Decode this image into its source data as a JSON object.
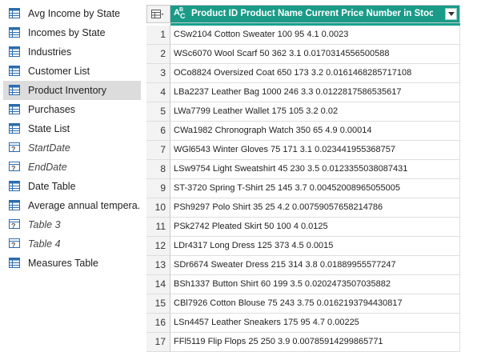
{
  "sidebar": {
    "items": [
      {
        "label": "Avg Income by State",
        "type": "table",
        "selected": false
      },
      {
        "label": "Incomes by State",
        "type": "table",
        "selected": false
      },
      {
        "label": "Industries",
        "type": "table",
        "selected": false
      },
      {
        "label": "Customer List",
        "type": "table",
        "selected": false
      },
      {
        "label": "Product Inventory",
        "type": "table",
        "selected": true
      },
      {
        "label": "Purchases",
        "type": "table",
        "selected": false
      },
      {
        "label": "State List",
        "type": "table",
        "selected": false
      },
      {
        "label": "StartDate",
        "type": "parameter",
        "selected": false
      },
      {
        "label": "EndDate",
        "type": "parameter",
        "selected": false
      },
      {
        "label": "Date Table",
        "type": "table",
        "selected": false
      },
      {
        "label": "Average annual tempera...",
        "type": "table",
        "selected": false
      },
      {
        "label": "Table 3",
        "type": "parameter",
        "selected": false
      },
      {
        "label": "Table 4",
        "type": "parameter",
        "selected": false
      },
      {
        "label": "Measures Table",
        "type": "table",
        "selected": false
      }
    ]
  },
  "grid": {
    "column_type_icon": "abc-text-type-icon",
    "column_header": "Product ID Product Name Current Price Number in Stock Cust...",
    "accent_color": "#1a9b88",
    "rows": [
      {
        "num": "1",
        "value": "CSw2104 Cotton Sweater 100 95 4.1 0.0023"
      },
      {
        "num": "2",
        "value": "WSc6070 Wool Scarf 50 362 3.1 0.0170314556500588"
      },
      {
        "num": "3",
        "value": "OCo8824 Oversized Coat 650 173 3.2 0.0161468285717108"
      },
      {
        "num": "4",
        "value": "LBa2237 Leather Bag 1000 246 3.3 0.0122817586535617"
      },
      {
        "num": "5",
        "value": "LWa7799 Leather Wallet 175 105 3.2 0.02"
      },
      {
        "num": "6",
        "value": "CWa1982 Chronograph Watch 350 65 4.9 0.00014"
      },
      {
        "num": "7",
        "value": "WGl6543 Winter Gloves 75 171 3.1 0.023441955368757"
      },
      {
        "num": "8",
        "value": "LSw9754 Light Sweatshirt 45 230 3.5 0.0123355038087431"
      },
      {
        "num": "9",
        "value": "ST-3720 Spring T-Shirt 25 145 3.7 0.00452008965055005"
      },
      {
        "num": "10",
        "value": "PSh9297 Polo Shirt 35 25 4.2 0.00759057658214786"
      },
      {
        "num": "11",
        "value": "PSk2742 Pleated Skirt 50 100 4 0.0125"
      },
      {
        "num": "12",
        "value": "LDr4317 Long Dress 125 373 4.5 0.0015"
      },
      {
        "num": "13",
        "value": "SDr6674 Sweater Dress 215 314 3.8 0.01889955577247"
      },
      {
        "num": "14",
        "value": "BSh1337 Button Shirt 60 199 3.5 0.0202473507035882"
      },
      {
        "num": "15",
        "value": "CBl7926 Cotton Blouse 75 243 3.75 0.0162193794430817"
      },
      {
        "num": "16",
        "value": "LSn4457 Leather Sneakers 175 95 4.7 0.00225"
      },
      {
        "num": "17",
        "value": "FFl5119 Flip Flops 25 250 3.9 0.00785914299865771"
      }
    ]
  }
}
